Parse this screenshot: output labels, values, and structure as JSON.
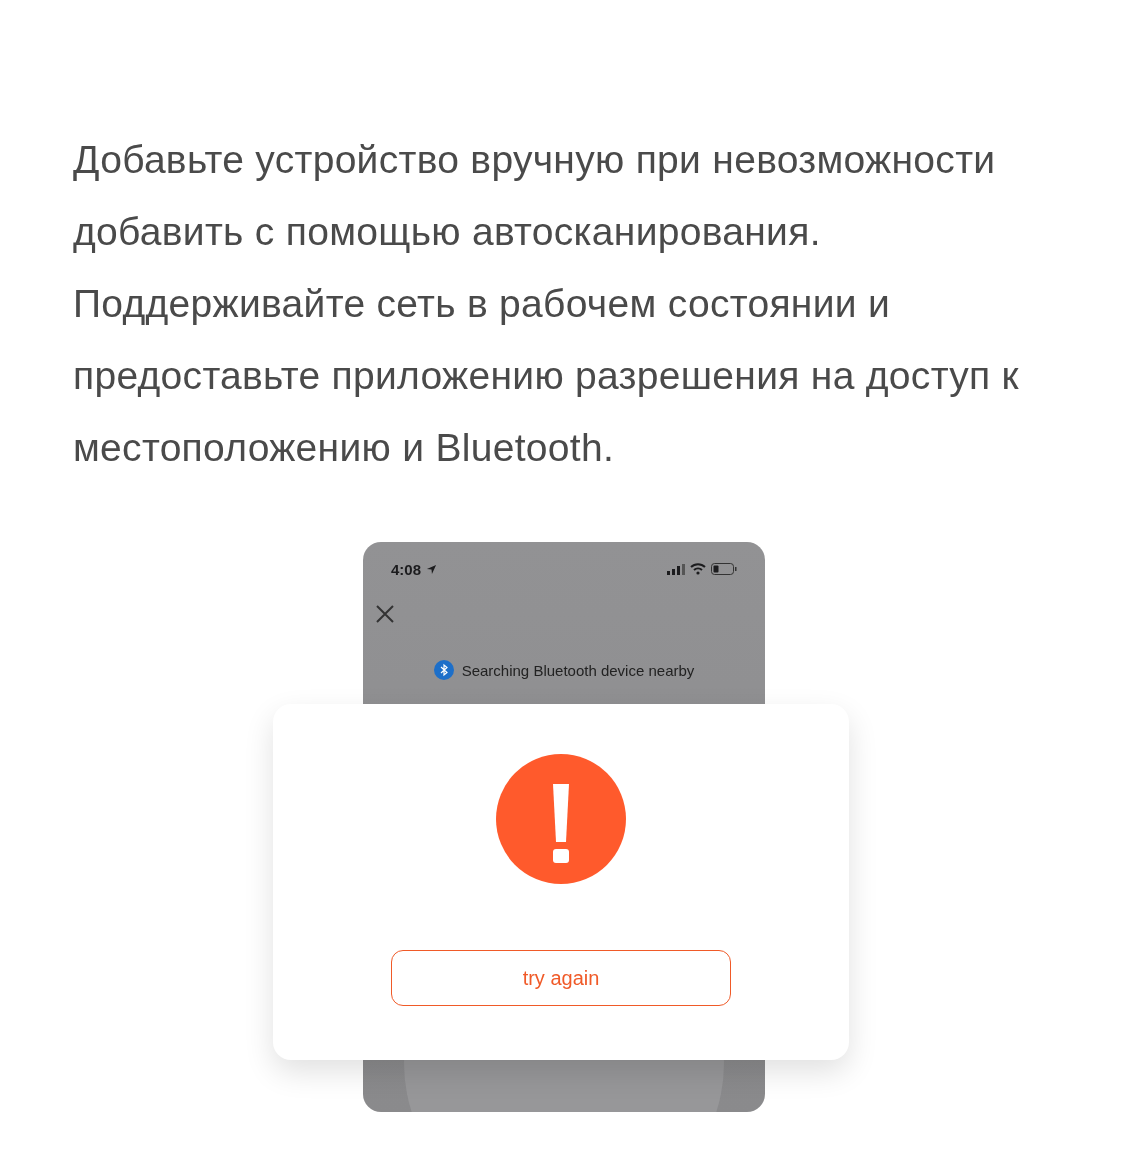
{
  "instruction": "Добавьте устройство вручную при невозможности добавить с помощью автосканирования. Поддерживайте сеть в рабочем состоянии и предоставьте приложению разрешения на доступ к местоположению и Bluetooth.",
  "phone_screenshot": {
    "status_bar": {
      "time": "4:08"
    },
    "search_status": "Searching Bluetooth device nearby",
    "dialog": {
      "button": "try again"
    }
  }
}
